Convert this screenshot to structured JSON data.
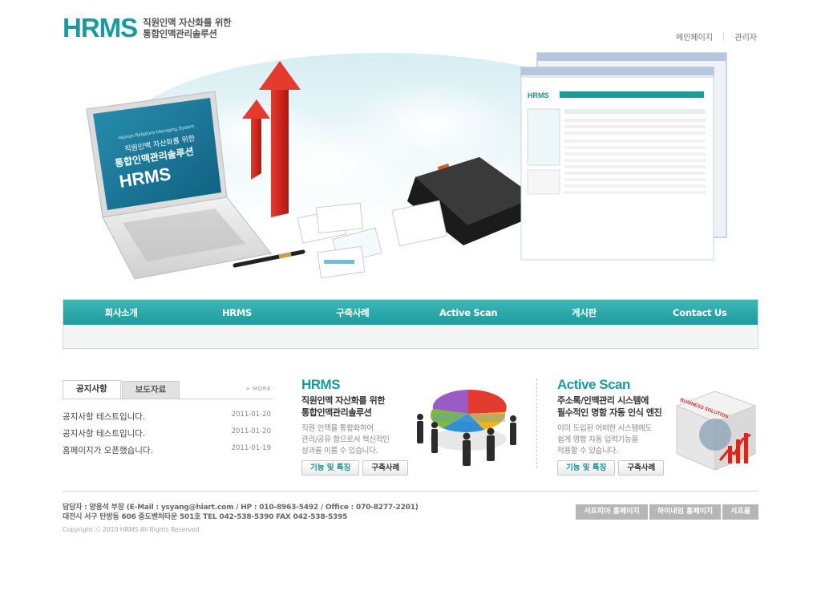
{
  "header": {
    "logo": "HRMS",
    "tagline_line1": "직원인맥 자산화를 위한",
    "tagline_line2": "통합인맥관리솔루션",
    "links": [
      "메인페이지",
      "관리자"
    ]
  },
  "hero": {
    "screen_line1": "Human Relations Managing System",
    "screen_line2": "직원인맥 자산화를 위한",
    "screen_line3": "통합인맥관리솔루션",
    "screen_logo": "HRMS"
  },
  "nav": {
    "items": [
      "회사소개",
      "HRMS",
      "구축사례",
      "Active Scan",
      "게시판",
      "Contact Us"
    ]
  },
  "notice": {
    "tabs": [
      "공지사항",
      "보도자료"
    ],
    "more": "+ MORE",
    "items": [
      {
        "title": "공지사항 테스트입니다.",
        "date": "2011-01-20"
      },
      {
        "title": "공지사항 테스트입니다.",
        "date": "2011-01-20"
      },
      {
        "title": "홈페이지가 오픈했습니다.",
        "date": "2011-01-19"
      }
    ]
  },
  "promo_hrms": {
    "title": "HRMS",
    "sub1": "직원인맥 자산화를 위한",
    "sub2": "통합인맥관리솔루션",
    "desc1": "직원 인맥을 통합화하여",
    "desc2": "관리/공유 함으로서 혁신적인",
    "desc3": "성과를 이룰 수 있습니다.",
    "btn1": "기능 및 특징",
    "btn2": "구축사례"
  },
  "promo_scan": {
    "title": "Active Scan",
    "sub1": "주소록/인맥관리 시스템에",
    "sub2": "필수적인 명함 자동 인식 엔진",
    "desc1": "이미 도입된 어떠한 시스템에도",
    "desc2": "쉽게 명함 자동 입력기능을",
    "desc3": "적용할 수 있습니다.",
    "btn1": "기능 및 특징",
    "btn2": "구축사례",
    "cube_label": "BUSINESS SOLUTION"
  },
  "footer": {
    "line1": "담당자 : 양용석 부장 (E-Mail : ysyang@hiart.com / HP : 010-8963-5492 / Office : 070-8277-2201)",
    "line2": "대전시 서구 탄방동 606 중도벤처타운 501호   TEL 042-538-5390  FAX 042-538-5395",
    "copyright": "Copyright ⓒ 2010 HRMS All Rights Reserved.",
    "links": [
      "서프피아 홈페이지",
      "하이내임 홈페이지",
      "서프몰"
    ]
  }
}
